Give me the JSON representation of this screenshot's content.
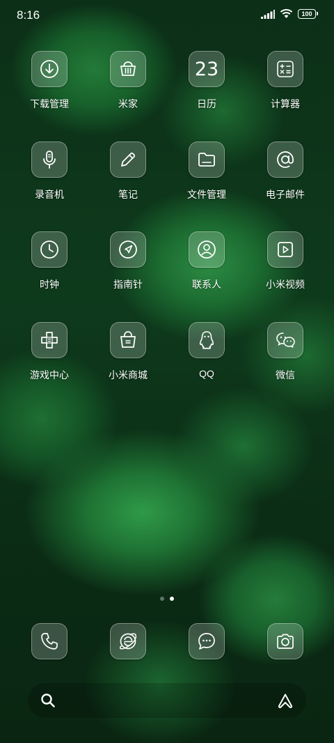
{
  "status_bar": {
    "time": "8:16",
    "battery": "100",
    "icons": [
      "signal-icon",
      "wifi-icon",
      "battery-icon"
    ]
  },
  "apps": [
    {
      "label": "下载管理",
      "icon": "download-icon"
    },
    {
      "label": "米家",
      "icon": "basket-icon"
    },
    {
      "label": "日历",
      "icon": "calendar-icon",
      "date": "23"
    },
    {
      "label": "计算器",
      "icon": "calculator-icon"
    },
    {
      "label": "录音机",
      "icon": "microphone-icon"
    },
    {
      "label": "笔记",
      "icon": "pencil-icon"
    },
    {
      "label": "文件管理",
      "icon": "folder-icon"
    },
    {
      "label": "电子邮件",
      "icon": "at-sign-icon"
    },
    {
      "label": "时钟",
      "icon": "clock-icon"
    },
    {
      "label": "指南针",
      "icon": "compass-icon"
    },
    {
      "label": "联系人",
      "icon": "contact-icon"
    },
    {
      "label": "小米视频",
      "icon": "play-icon"
    },
    {
      "label": "游戏中心",
      "icon": "gamepad-cross-icon"
    },
    {
      "label": "小米商城",
      "icon": "shopping-bag-icon"
    },
    {
      "label": "QQ",
      "icon": "qq-penguin-icon"
    },
    {
      "label": "微信",
      "icon": "wechat-icon"
    }
  ],
  "page_indicator": {
    "pages": 2,
    "active": 2
  },
  "dock": [
    {
      "name": "phone",
      "icon": "phone-icon"
    },
    {
      "name": "browser",
      "icon": "browser-icon"
    },
    {
      "name": "messages",
      "icon": "message-icon"
    },
    {
      "name": "camera",
      "icon": "camera-icon"
    }
  ],
  "search_bar": {
    "left_icon": "search-icon",
    "right_icon": "assistant-icon"
  }
}
